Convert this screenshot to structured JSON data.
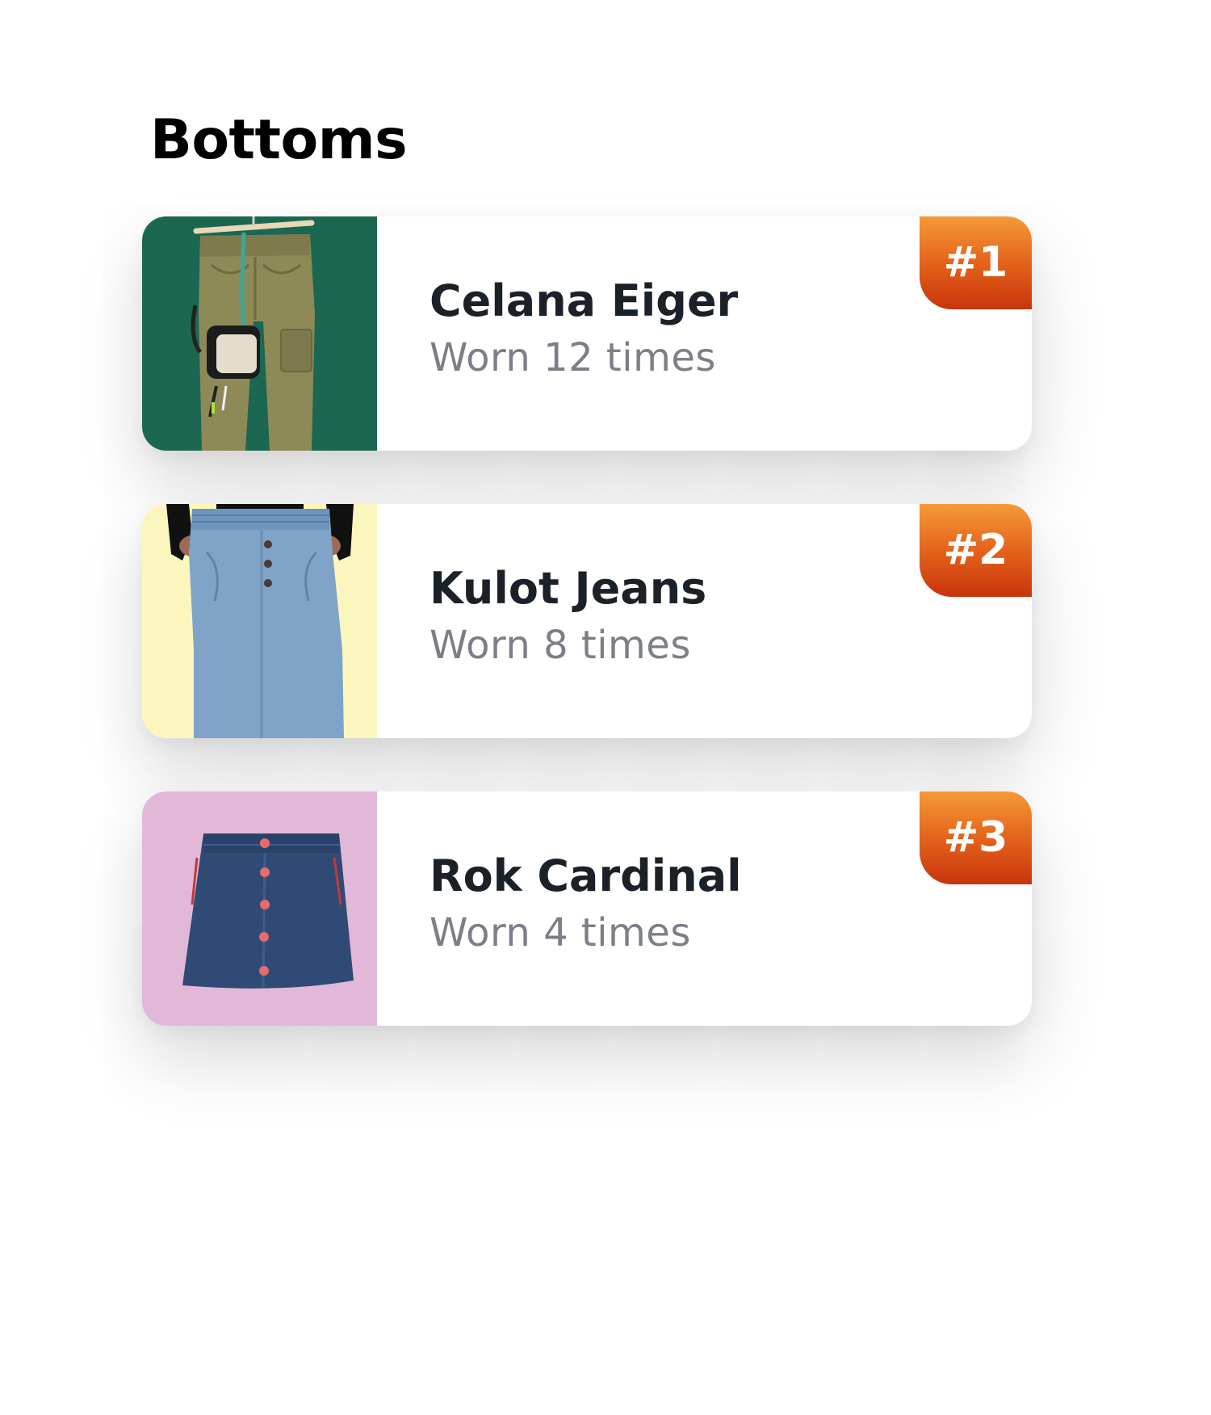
{
  "section": {
    "title": "Bottoms"
  },
  "items": [
    {
      "rank": "#1",
      "name": "Celana Eiger",
      "worn": "Worn 12 times",
      "thumb_bg": "#1b6751",
      "thumb_icon": "cargo-pants-icon"
    },
    {
      "rank": "#2",
      "name": "Kulot Jeans",
      "worn": "Worn 8 times",
      "thumb_bg": "#fbf6be",
      "thumb_icon": "wide-jeans-icon"
    },
    {
      "rank": "#3",
      "name": "Rok Cardinal",
      "worn": "Worn 4 times",
      "thumb_bg": "#e2b8d8",
      "thumb_icon": "denim-skirt-icon"
    }
  ],
  "colors": {
    "badge_top": "#f49a3a",
    "badge_bottom": "#c9340c",
    "name_text": "#1b2129",
    "worn_text": "#7c7f87"
  }
}
